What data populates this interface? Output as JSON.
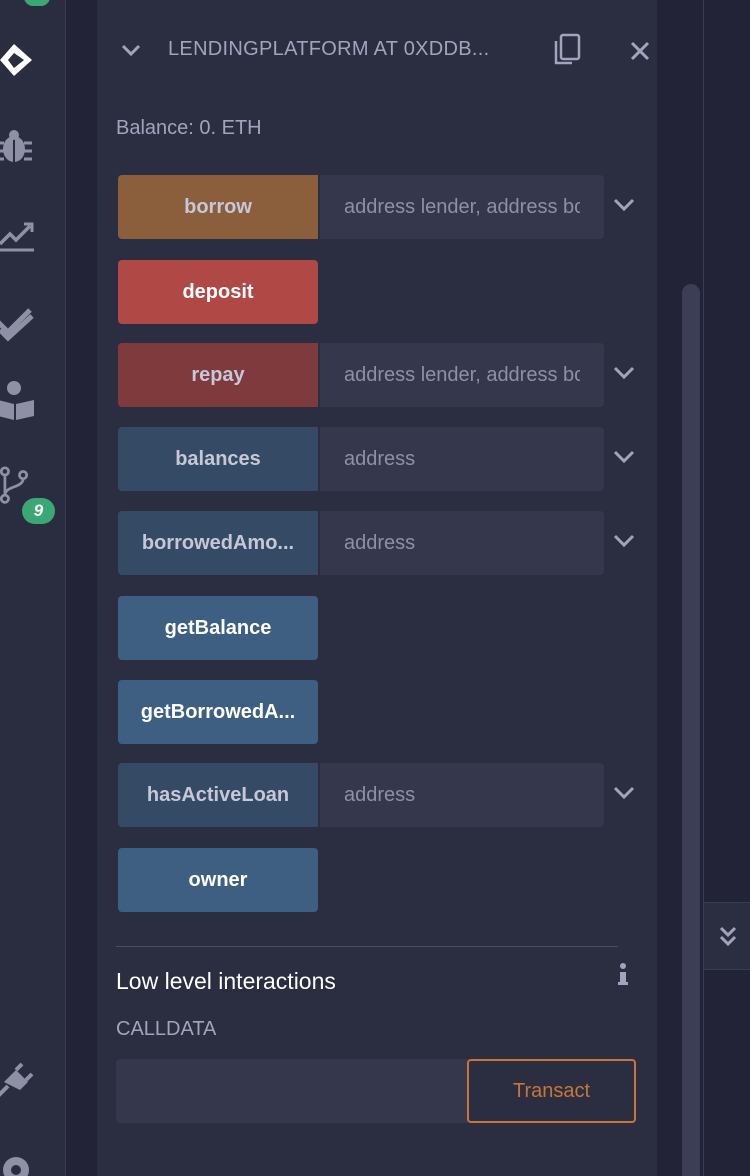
{
  "sidebar": {
    "icons": [
      "remix-logo-icon",
      "debug-bug-icon",
      "analytics-chart-icon",
      "double-check-icon",
      "learn-book-icon",
      "git-branch-icon",
      "plugin-plug-icon",
      "settings-gear-icon"
    ],
    "git_badge": "9"
  },
  "contract": {
    "title": "LENDINGPLATFORM AT 0XDDB...",
    "balance": "Balance: 0. ETH"
  },
  "functions": [
    {
      "label": "borrow",
      "placeholder": "address lender, address bo",
      "kind": "payable"
    },
    {
      "label": "deposit",
      "kind": "payable-noinput"
    },
    {
      "label": "repay",
      "placeholder": "address lender, address bo",
      "kind": "nonpayable"
    },
    {
      "label": "balances",
      "placeholder": "address",
      "kind": "view"
    },
    {
      "label": "borrowedAmo...",
      "placeholder": "address",
      "kind": "view"
    },
    {
      "label": "getBalance",
      "kind": "view-noinput"
    },
    {
      "label": "getBorrowedA...",
      "kind": "view-noinput"
    },
    {
      "label": "hasActiveLoan",
      "placeholder": "address",
      "kind": "view"
    },
    {
      "label": "owner",
      "kind": "view-noinput"
    }
  ],
  "low_level": {
    "title": "Low level interactions",
    "calldata_label": "CALLDATA",
    "transact_label": "Transact"
  },
  "colors": {
    "payable": "#8b5e3c",
    "deposit": "#b04846",
    "nonpayable": "#7e3a3d",
    "view": "#344a65",
    "view_noinput": "#3e5f82",
    "accent": "#c97539",
    "badge": "#3ca675"
  }
}
